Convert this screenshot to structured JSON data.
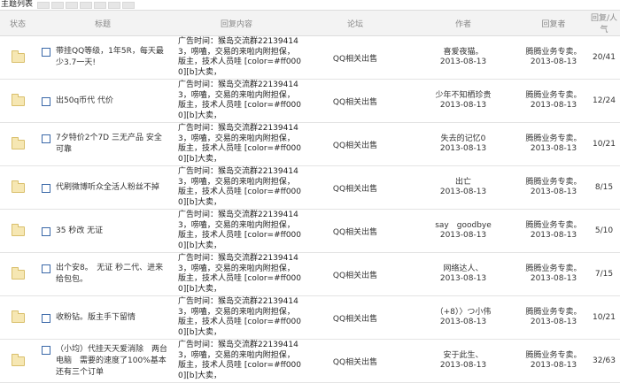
{
  "header": {
    "title": "主题列表"
  },
  "columns": [
    "状态",
    "标题",
    "回复内容",
    "论坛",
    "作者",
    "回复者",
    "回复/人气"
  ],
  "rows": [
    {
      "title": "带挂QQ等级，1年5R，每天最少3.7一天!",
      "content": "广告时间：猴岛交流群221394143，唠嗑，交易的来啦内附担保，版主，技术人员哇 [color=#ff0000][b]大卖，",
      "forum": "QQ相关出售",
      "author": "喜爱夜猫。",
      "date": "2013-08-13",
      "replier": "腾腾业务专卖。",
      "replier_date": "2013-08-13",
      "count": "20/41"
    },
    {
      "title": "出50q币代 代价",
      "content": "广告时间：猴岛交流群221394143，唠嗑，交易的来啦内附担保，版主，技术人员哇 [color=#ff0000][b]大卖，",
      "forum": "QQ相关出售",
      "author": "少年不知栖珍贵",
      "date": "2013-08-13",
      "replier": "腾腾业务专卖。",
      "replier_date": "2013-08-13",
      "count": "12/24"
    },
    {
      "title": "7夕特价2个7D 三无产品 安全可靠",
      "content": "广告时间：猴岛交流群221394143，唠嗑，交易的来啦内附担保，版主，技术人员哇 [color=#ff0000][b]大卖，",
      "forum": "QQ相关出售",
      "author": "失去的记忆0",
      "date": "2013-08-13",
      "replier": "腾腾业务专卖。",
      "replier_date": "2013-08-13",
      "count": "10/21"
    },
    {
      "title": "代刷微博听众全活人粉丝不掉",
      "content": "广告时间：猴岛交流群221394143，唠嗑，交易的来啦内附担保，版主，技术人员哇 [color=#ff0000][b]大卖，",
      "forum": "QQ相关出售",
      "author": "出亡",
      "date": "2013-08-13",
      "replier": "腾腾业务专卖。",
      "replier_date": "2013-08-13",
      "count": "8/15"
    },
    {
      "title": "35 秒改 无证",
      "content": "广告时间：猴岛交流群221394143，唠嗑，交易的来啦内附担保，版主，技术人员哇 [color=#ff0000][b]大卖，",
      "forum": "QQ相关出售",
      "author": "say　goodbye",
      "date": "2013-08-13",
      "replier": "腾腾业务专卖。",
      "replier_date": "2013-08-13",
      "count": "5/10"
    },
    {
      "title": "出个安8。　无证 秒二代、进来给包包。",
      "content": "广告时间：猴岛交流群221394143，唠嗑，交易的来啦内附担保，版主，技术人员哇 [color=#ff0000][b]大卖，",
      "forum": "QQ相关出售",
      "author": "网络达人、",
      "date": "2013-08-13",
      "replier": "腾腾业务专卖。",
      "replier_date": "2013-08-13",
      "count": "7/15"
    },
    {
      "title": "收粉钻。版主手下留情",
      "content": "广告时间：猴岛交流群221394143，唠嗑，交易的来啦内附担保，版主，技术人员哇 [color=#ff0000][b]大卖，",
      "forum": "QQ相关出售",
      "author": "（+8）〉つ小伟",
      "date": "2013-08-13",
      "replier": "腾腾业务专卖。",
      "replier_date": "2013-08-13",
      "count": "10/21"
    },
    {
      "title": "（小均）代挂天天爱消除　两台电脑　需要的速度了100%基本 还有三个订单",
      "content": "广告时间：猴岛交流群221394143，唠嗑，交易的来啦内附担保，版主，技术人员哇 [color=#ff0000][b]大卖，",
      "forum": "QQ相关出售",
      "author": "安于此生、",
      "date": "2013-08-13",
      "replier": "腾腾业务专卖。",
      "replier_date": "2013-08-13",
      "count": "32/63"
    }
  ]
}
